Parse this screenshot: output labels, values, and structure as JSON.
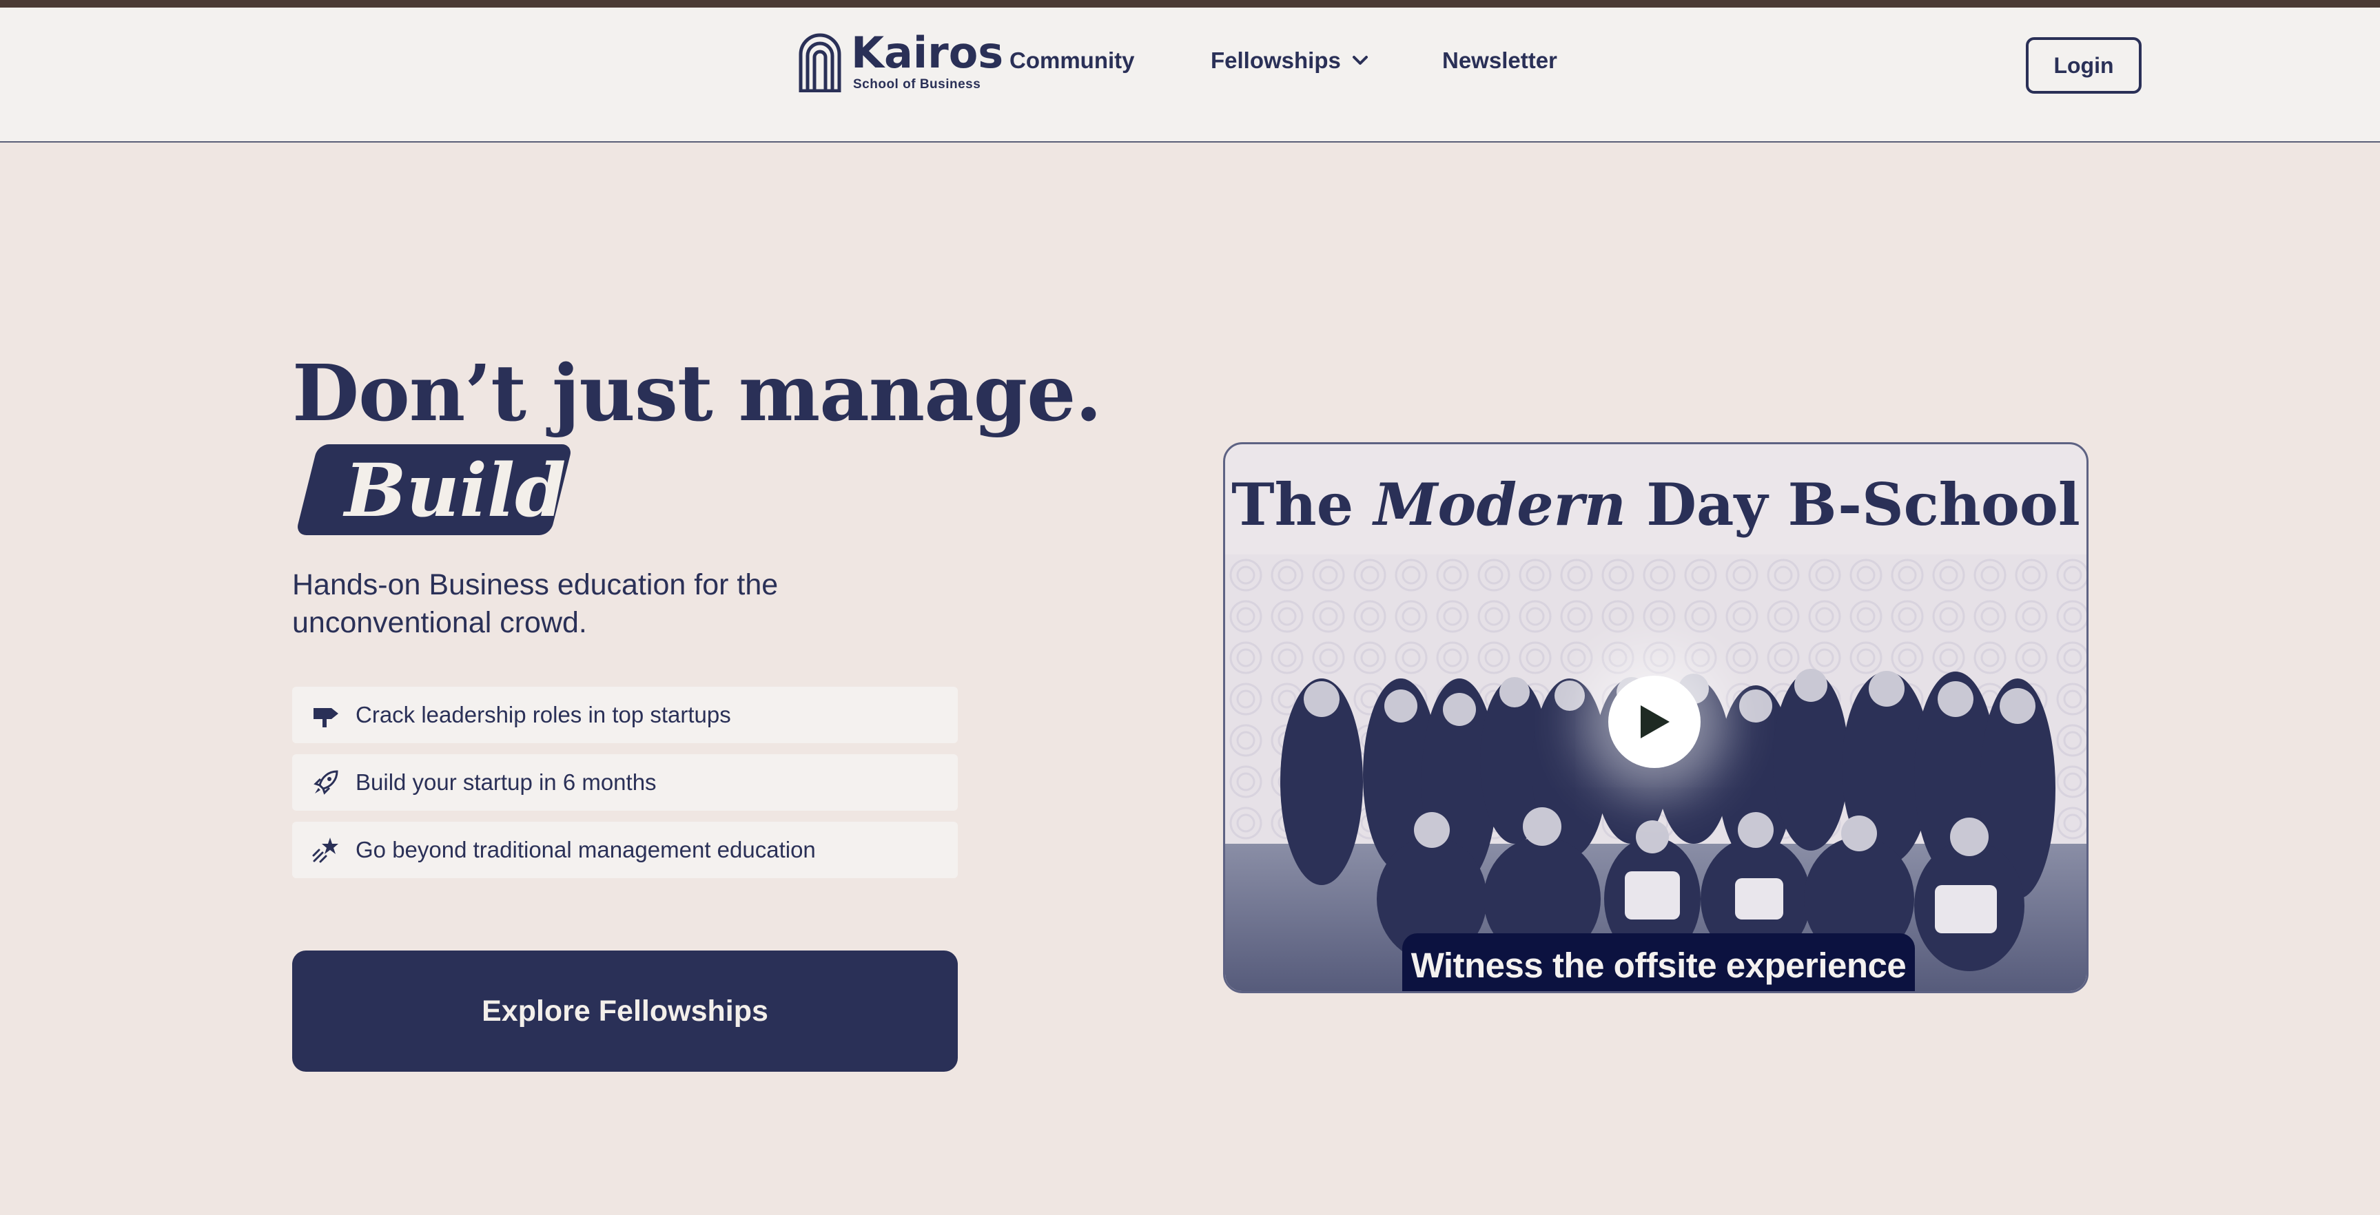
{
  "colors": {
    "primary": "#2a3057",
    "page_bg": "#efe6e2",
    "nav_bg": "#f3f1ef",
    "topbar": "#4b3b35",
    "badge_bg": "#0c1240"
  },
  "nav": {
    "logo_name": "Kairos",
    "logo_sub": "School of Business",
    "links": [
      {
        "label": "Community"
      },
      {
        "label": "Fellowships",
        "icon": "chevron-down-icon"
      },
      {
        "label": "Newsletter"
      }
    ],
    "login_label": "Login"
  },
  "hero": {
    "title_line1": "Don’t just manage.",
    "title_badge": "Build",
    "subtitle": "Hands-on Business education for the unconventional crowd.",
    "features": [
      {
        "icon": "signpost-icon",
        "text": "Crack leadership roles in top startups"
      },
      {
        "icon": "rocket-icon",
        "text": "Build your startup in 6 months"
      },
      {
        "icon": "shooting-star-icon",
        "text": "Go beyond traditional management education"
      }
    ],
    "cta_label": "Explore Fellowships"
  },
  "video": {
    "title_pre": "The ",
    "title_italic": "Modern",
    "title_post": " Day B-School",
    "caption": "Witness the offsite experience",
    "play_icon": "play-icon"
  }
}
